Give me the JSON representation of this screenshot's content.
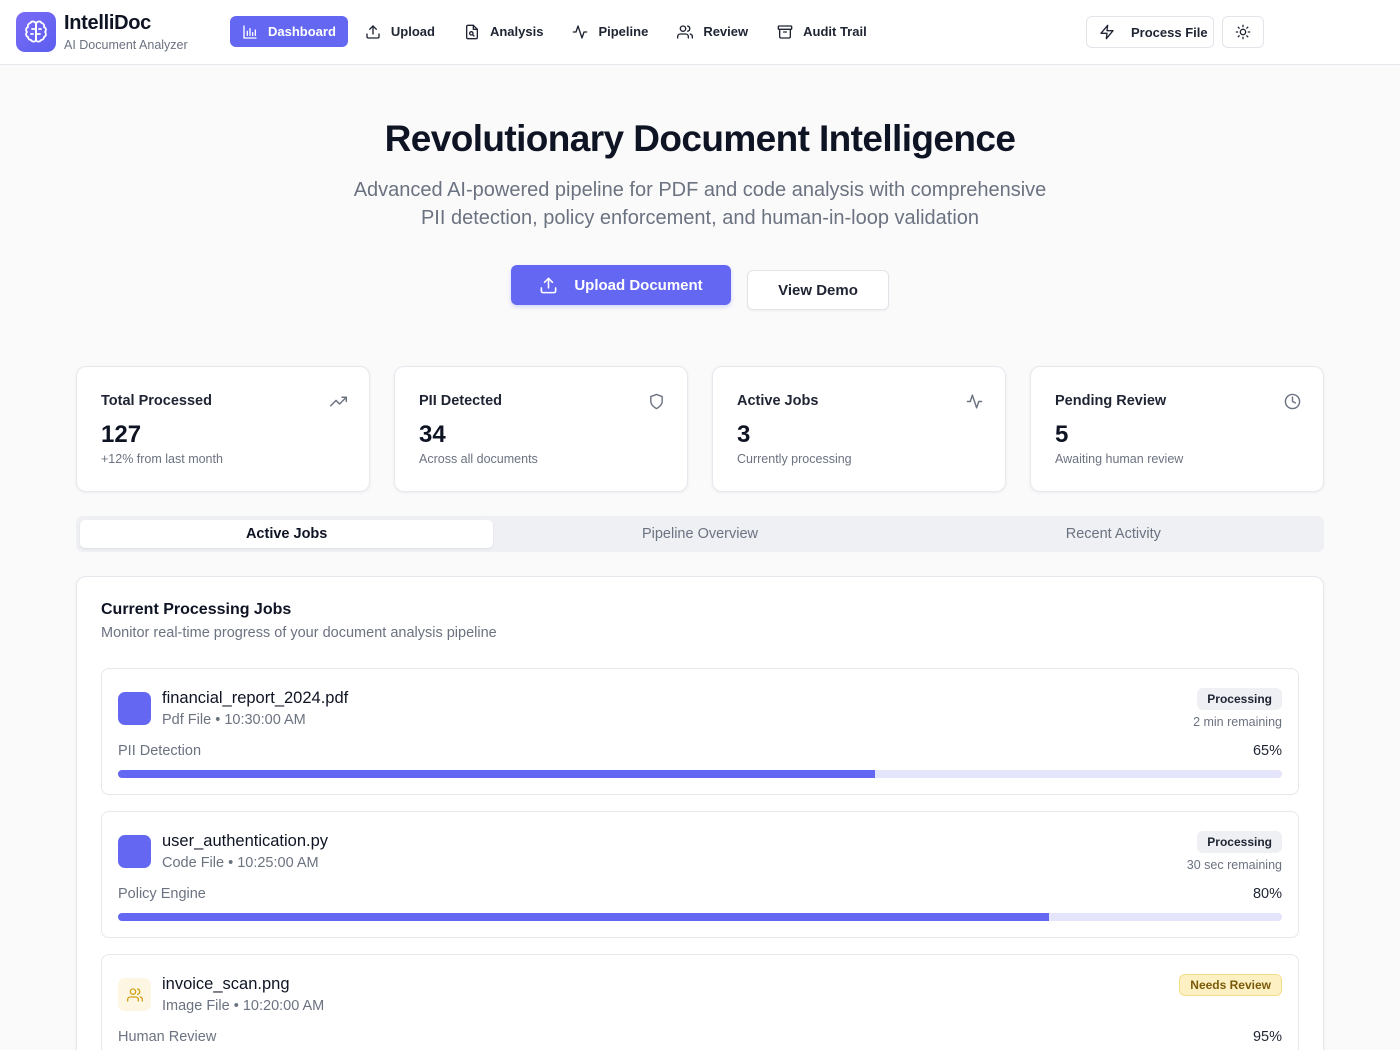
{
  "brand": {
    "name": "IntelliDoc",
    "tagline": "AI Document Analyzer"
  },
  "nav": [
    {
      "label": "Dashboard",
      "icon": "bar-chart-icon",
      "active": true
    },
    {
      "label": "Upload",
      "icon": "upload-icon",
      "active": false
    },
    {
      "label": "Analysis",
      "icon": "file-search-icon",
      "active": false
    },
    {
      "label": "Pipeline",
      "icon": "activity-icon",
      "active": false
    },
    {
      "label": "Review",
      "icon": "users-icon",
      "active": false
    },
    {
      "label": "Audit Trail",
      "icon": "archive-icon",
      "active": false
    }
  ],
  "header_actions": {
    "process_label": "Process File",
    "theme_icon": "sun-icon"
  },
  "hero": {
    "title": "Revolutionary Document Intelligence",
    "subtitle_line1": "Advanced AI-powered pipeline for PDF and code analysis with comprehensive",
    "subtitle_line2": "PII detection, policy enforcement, and human-in-loop validation",
    "upload_label": "Upload Document",
    "demo_label": "View Demo"
  },
  "stats": [
    {
      "label": "Total Processed",
      "value": "127",
      "sub": "+12% from last month",
      "icon": "trending-up-icon"
    },
    {
      "label": "PII Detected",
      "value": "34",
      "sub": "Across all documents",
      "icon": "shield-icon"
    },
    {
      "label": "Active Jobs",
      "value": "3",
      "sub": "Currently processing",
      "icon": "activity-icon"
    },
    {
      "label": "Pending Review",
      "value": "5",
      "sub": "Awaiting human review",
      "icon": "clock-icon"
    }
  ],
  "tabs": [
    {
      "label": "Active Jobs",
      "active": true
    },
    {
      "label": "Pipeline Overview",
      "active": false
    },
    {
      "label": "Recent Activity",
      "active": false
    }
  ],
  "jobs_panel": {
    "title": "Current Processing Jobs",
    "subtitle": "Monitor real-time progress of your document analysis pipeline",
    "jobs": [
      {
        "name": "financial_report_2024.pdf",
        "type": "Pdf File",
        "time": "10:30:00 AM",
        "status": "Processing",
        "remaining": "2 min remaining",
        "stage": "PII Detection",
        "progress_pct": 65,
        "progress_label": "65%",
        "icon_color": "#6467f2"
      },
      {
        "name": "user_authentication.py",
        "type": "Code File",
        "time": "10:25:00 AM",
        "status": "Processing",
        "remaining": "30 sec remaining",
        "stage": "Policy Engine",
        "progress_pct": 80,
        "progress_label": "80%",
        "icon_color": "#6467f2"
      },
      {
        "name": "invoice_scan.png",
        "type": "Image File",
        "time": "10:20:00 AM",
        "status": "Needs Review",
        "remaining": "",
        "stage": "Human Review",
        "progress_pct": 95,
        "progress_label": "95%",
        "icon_color": "#fdf6e3"
      }
    ]
  },
  "colors": {
    "accent": "#6467f2",
    "review_badge_bg": "#fdf1c4",
    "review_badge_text": "#7a5a08"
  }
}
